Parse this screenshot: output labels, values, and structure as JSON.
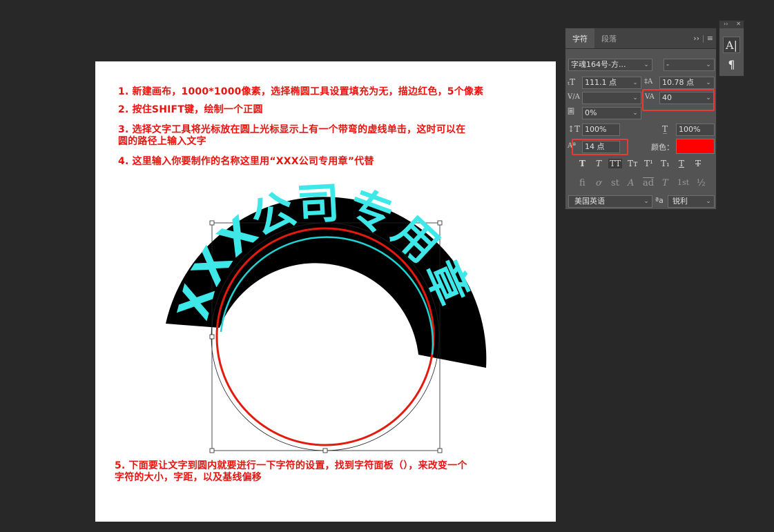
{
  "instructions": [
    "1. 新建画布，1000*1000像素，选择椭圆工具设置填充为无，描边红色，5个像素",
    "2. 按住SHIFT键，绘制一个正圆",
    "3. 选择文字工具将光标放在圆上光标显示上有一个带弯的虚线单击，这时可以在\n圆的路径上输入文字",
    "4. 这里输入你要制作的名称这里用“XXX公司专用章”代替",
    "5. 下面要让文字到圆内就要进行一下字符的设置，找到字符面板（），来改变一个\n字符的大小，字距，以及基线偏移"
  ],
  "arc_text": [
    "X",
    "X",
    "X",
    "公",
    "司",
    "专",
    "用",
    "章"
  ],
  "colors": {
    "canvas_bg": "#ffffff",
    "instruction_text": "#e8140f",
    "arc_text": "#3ee8e8",
    "arc_band": "#000000",
    "circle_stroke": "#e31b0e",
    "inner_path": "#1fd3d3",
    "swatch": "#ff0000",
    "highlight_box": "#e83b32",
    "panel_bg": "#535353",
    "app_bg": "#282828"
  },
  "panel": {
    "tabs": [
      "字符",
      "段落"
    ],
    "menu_icons": [
      "collapse-icon",
      "panel-menu-icon"
    ],
    "font_family": "字魂164号-方...",
    "font_style": "-",
    "font_size": "111.1 点",
    "leading": "10.78 点",
    "kerning": "",
    "tracking": "40",
    "tsume": "0%",
    "vertical_scale": "100%",
    "horizontal_scale": "100%",
    "baseline_shift": "14 点",
    "color_label": "颜色：",
    "format_buttons": [
      "T",
      "T",
      "TT",
      "Tт",
      "T¹",
      "T₁",
      "T",
      "T"
    ],
    "opentype_buttons": [
      "fi",
      "ơ",
      "st",
      "A",
      "ad",
      "T",
      "1st",
      "½"
    ],
    "language": "美国英语",
    "aa_label": "ªa",
    "antialias": "锐利"
  },
  "toolstrip": {
    "buttons": [
      "character-panel-icon",
      "paragraph-panel-icon"
    ]
  }
}
